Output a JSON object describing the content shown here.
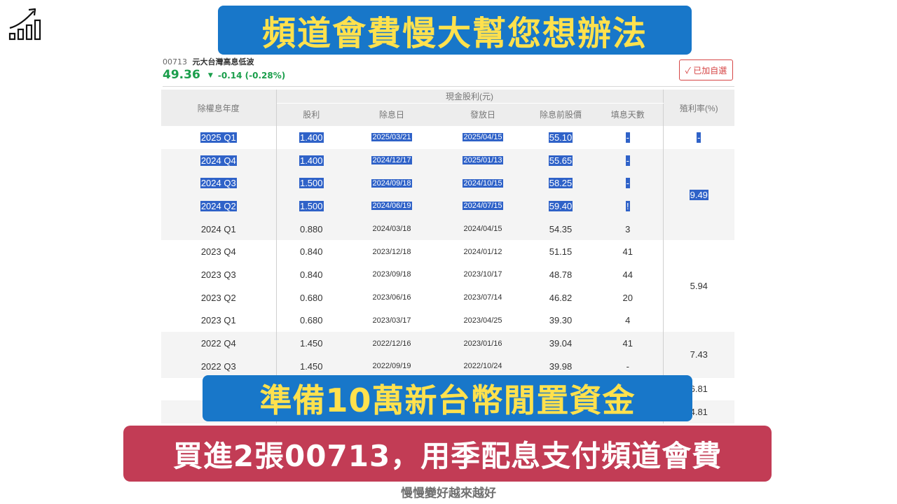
{
  "banners": {
    "top": "頻道會費慢大幫您想辦法",
    "middle": "準備10萬新台幣閒置資金",
    "bottom": "買進2張00713，用季配息支付頻道會費"
  },
  "footer": "慢慢變好越來越好",
  "logo_icon": "growth-chart-icon",
  "stock": {
    "code": "00713",
    "name": "元大台灣高息低波",
    "price": "49.36",
    "arrow": "▼",
    "change": "-0.14 (-0.28%)",
    "change_color": "#1a9e4b",
    "watch_button": "✓ 已加自選"
  },
  "table": {
    "headers": {
      "year": "除權息年度",
      "cash_group": "現金股利(元)",
      "dividend": "股利",
      "ex_date": "除息日",
      "pay_date": "發放日",
      "pre_price": "除息前股價",
      "fill_days": "填息天數",
      "yield": "殖利率(%)"
    },
    "rows": [
      {
        "year": "2025 Q1",
        "dividend": "1.400",
        "ex_date": "2025/03/21",
        "pay_date": "2025/04/15",
        "pre_price": "55.10",
        "fill_days": "-",
        "selected": true
      },
      {
        "year": "2024 Q4",
        "dividend": "1.400",
        "ex_date": "2024/12/17",
        "pay_date": "2025/01/13",
        "pre_price": "55.65",
        "fill_days": "-",
        "selected": true
      },
      {
        "year": "2024 Q3",
        "dividend": "1.500",
        "ex_date": "2024/09/18",
        "pay_date": "2024/10/15",
        "pre_price": "58.25",
        "fill_days": "-",
        "selected": true
      },
      {
        "year": "2024 Q2",
        "dividend": "1.500",
        "ex_date": "2024/06/19",
        "pay_date": "2024/07/15",
        "pre_price": "59.40",
        "fill_days": "!",
        "selected": true
      },
      {
        "year": "2024 Q1",
        "dividend": "0.880",
        "ex_date": "2024/03/18",
        "pay_date": "2024/04/15",
        "pre_price": "54.35",
        "fill_days": "3",
        "selected": false
      },
      {
        "year": "2023 Q4",
        "dividend": "0.840",
        "ex_date": "2023/12/18",
        "pay_date": "2024/01/12",
        "pre_price": "51.15",
        "fill_days": "41",
        "selected": false
      },
      {
        "year": "2023 Q3",
        "dividend": "0.840",
        "ex_date": "2023/09/18",
        "pay_date": "2023/10/17",
        "pre_price": "48.78",
        "fill_days": "44",
        "selected": false
      },
      {
        "year": "2023 Q2",
        "dividend": "0.680",
        "ex_date": "2023/06/16",
        "pay_date": "2023/07/14",
        "pre_price": "46.82",
        "fill_days": "20",
        "selected": false
      },
      {
        "year": "2023 Q1",
        "dividend": "0.680",
        "ex_date": "2023/03/17",
        "pay_date": "2023/04/25",
        "pre_price": "39.30",
        "fill_days": "4",
        "selected": false
      },
      {
        "year": "2022 Q4",
        "dividend": "1.450",
        "ex_date": "2022/12/16",
        "pay_date": "2023/01/16",
        "pre_price": "39.04",
        "fill_days": "41",
        "selected": false
      },
      {
        "year": "2022 Q3",
        "dividend": "1.450",
        "ex_date": "2022/09/19",
        "pay_date": "2022/10/24",
        "pre_price": "39.98",
        "fill_days": "-",
        "selected": false
      },
      {
        "year": "",
        "dividend": "",
        "ex_date": "",
        "pay_date": "",
        "pre_price": "",
        "fill_days": "",
        "selected": false
      },
      {
        "year": "",
        "dividend": "",
        "ex_date": "",
        "pay_date": "",
        "pre_price": "",
        "fill_days": "",
        "selected": false
      }
    ],
    "yields": [
      {
        "value": "-",
        "span": 1,
        "selected": true
      },
      {
        "value": "9.49",
        "span": 4,
        "selected": true
      },
      {
        "value": "5.94",
        "span": 4,
        "selected": false
      },
      {
        "value": "7.43",
        "span": 2,
        "selected": false
      },
      {
        "value": "6.81",
        "span": 1,
        "selected": false
      },
      {
        "value": "4.81",
        "span": 1,
        "selected": false
      }
    ],
    "selection_color": "#2f62c8"
  }
}
